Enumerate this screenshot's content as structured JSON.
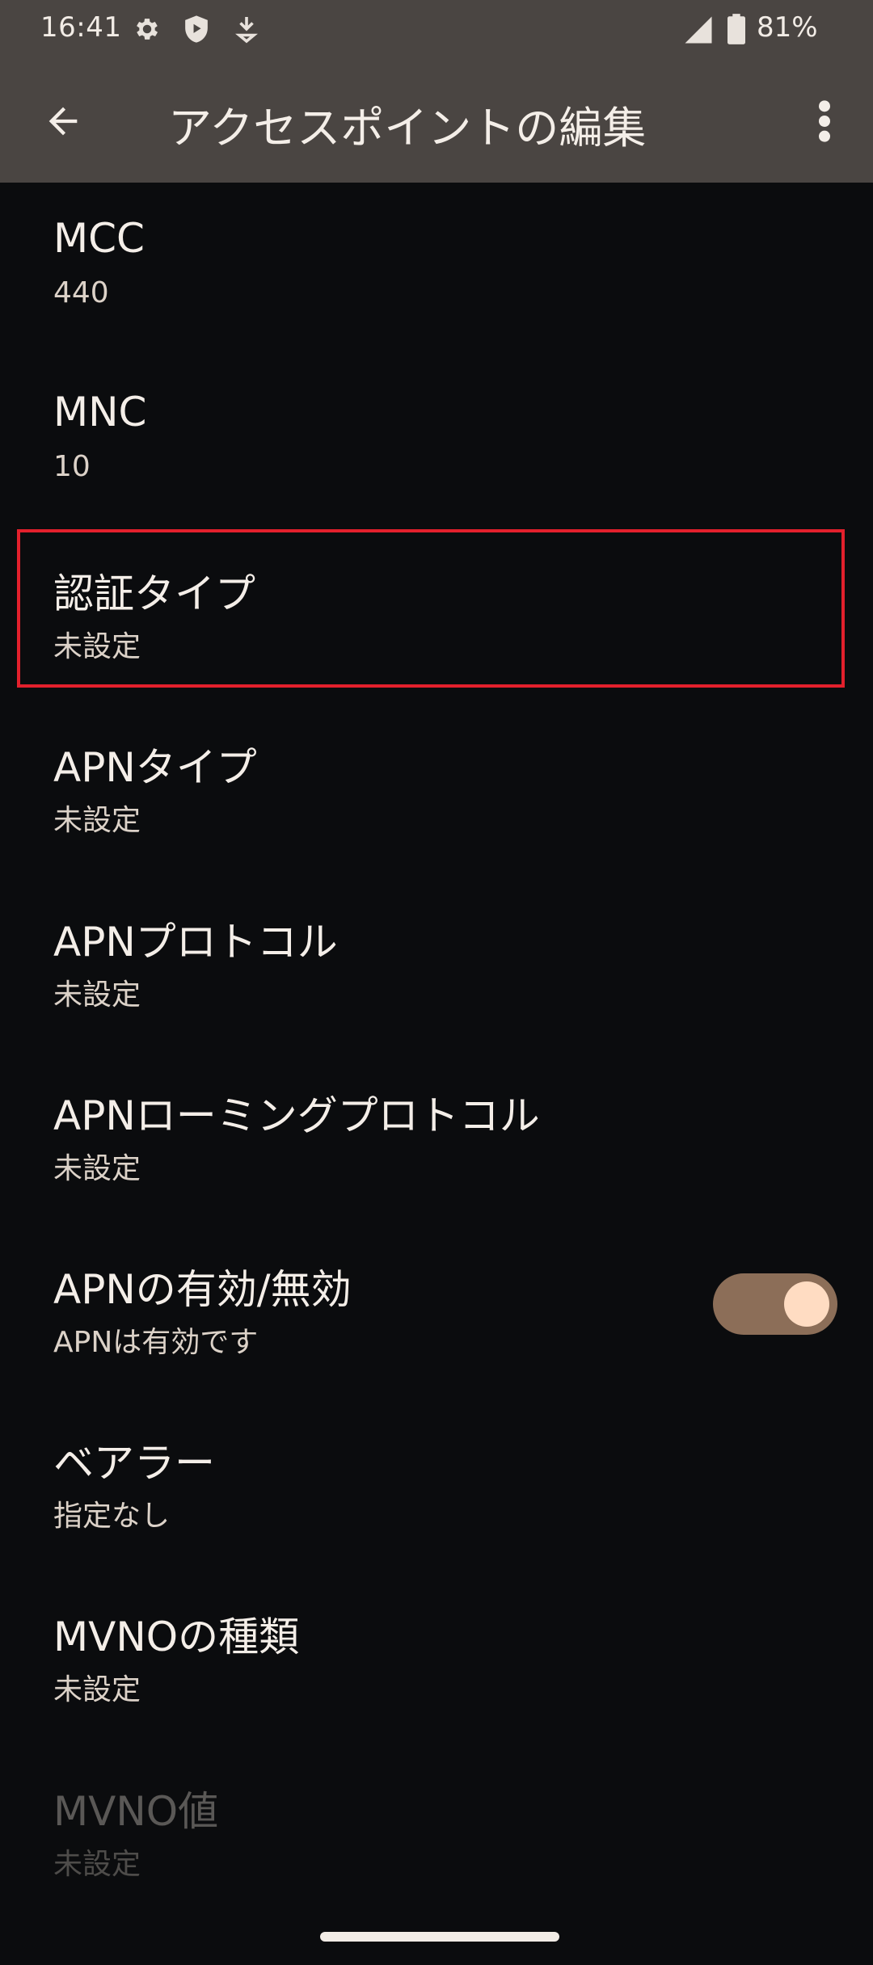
{
  "status_bar": {
    "time": "16:41",
    "battery_percent": "81%",
    "icons": [
      "settings-gear-icon",
      "shield-play-icon",
      "download-icon",
      "signal-icon",
      "battery-icon"
    ]
  },
  "app_bar": {
    "title": "アクセスポイントの編集",
    "back_icon": "arrow-left-icon",
    "menu_icon": "more-vert-icon"
  },
  "items": [
    {
      "title": "MCC",
      "value": "440"
    },
    {
      "title": "MNC",
      "value": "10"
    },
    {
      "title": "認証タイプ",
      "value": "未設定"
    },
    {
      "title": "APNタイプ",
      "value": "未設定"
    },
    {
      "title": "APNプロトコル",
      "value": "未設定"
    },
    {
      "title": "APNローミングプロトコル",
      "value": "未設定"
    },
    {
      "title": "APNの有効/無効",
      "value": "APNは有効です",
      "toggle_on": true
    },
    {
      "title": "ベアラー",
      "value": "指定なし"
    },
    {
      "title": "MVNOの種類",
      "value": "未設定"
    },
    {
      "title": "MVNO値",
      "value": "未設定",
      "disabled": true
    }
  ],
  "colors": {
    "app_bar_bg": "#4a4542",
    "background": "#0b0c0e",
    "highlight_border": "#e3202c",
    "toggle_track": "#8c6e58",
    "toggle_thumb": "#ffdcc2"
  }
}
